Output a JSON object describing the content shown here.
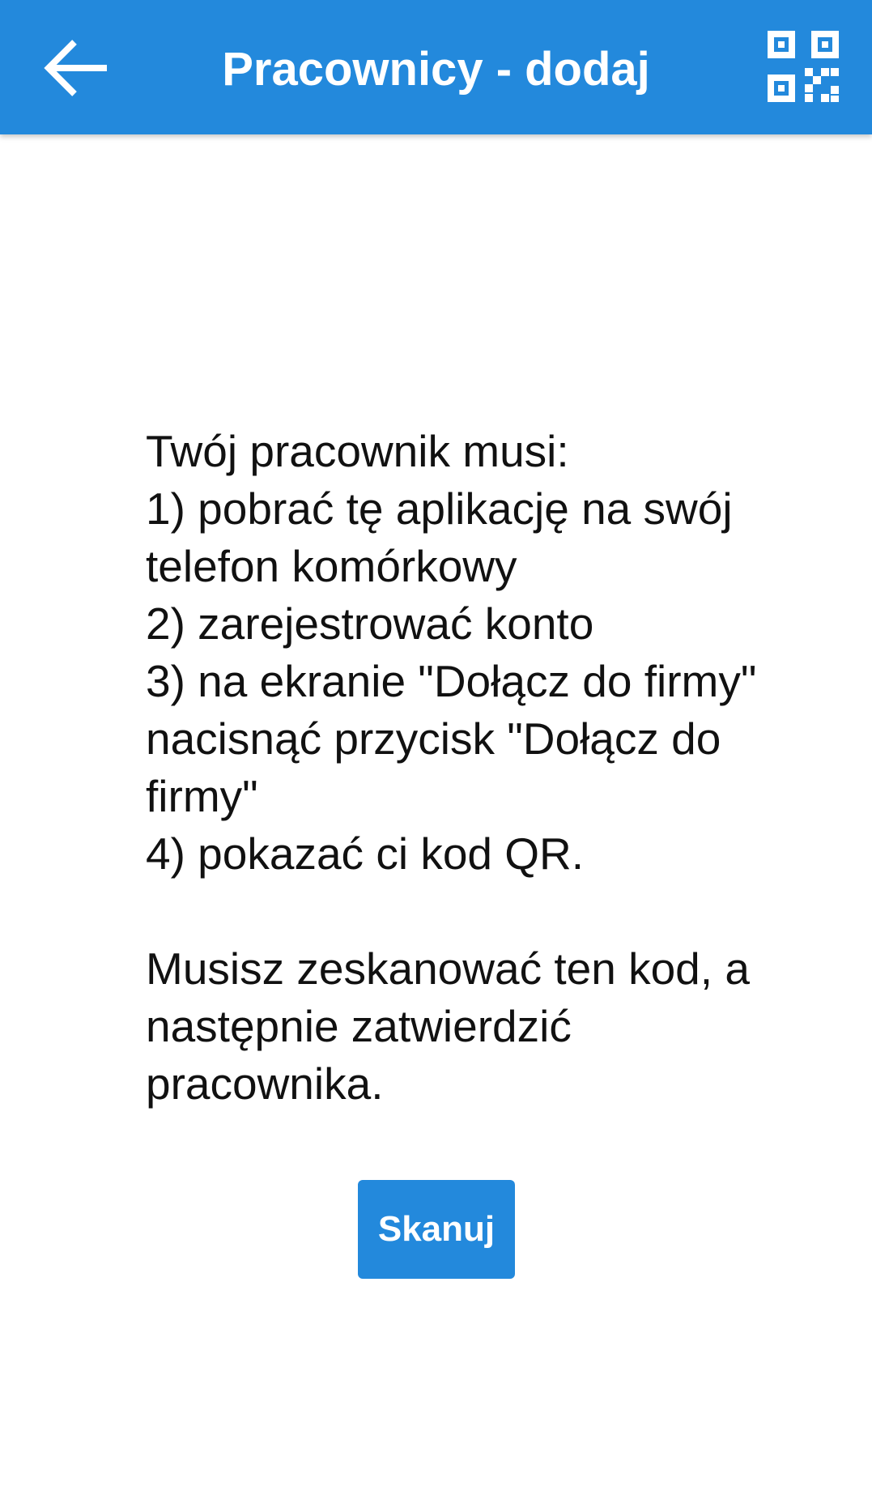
{
  "header": {
    "title": "Pracownicy - dodaj",
    "back_icon": "arrow-left-icon",
    "qr_icon": "qr-code-icon",
    "background_color": "#2389dc",
    "foreground_color": "#ffffff"
  },
  "main": {
    "instructions": "Twój pracownik musi:\n1) pobrać tę aplikację na swój telefon komórkowy\n2) zarejestrować konto\n3) na ekranie \"Dołącz do firmy\" nacisnąć przycisk \"Dołącz do firmy\"\n4) pokazać ci kod QR.\n\nMusisz zeskanować ten kod, a następnie zatwierdzić pracownika.",
    "scan_button_label": "Skanuj",
    "text_color": "#111111"
  }
}
